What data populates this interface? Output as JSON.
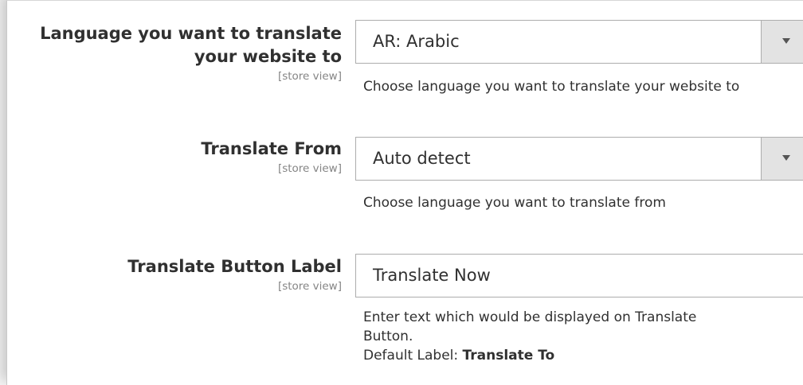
{
  "fields": [
    {
      "label_line1": "Language you want to translate",
      "label_line2": "your website to",
      "scope": "[store view]",
      "value": "AR: Arabic",
      "note": "Choose language you want to translate your website to"
    },
    {
      "label": "Translate From",
      "scope": "[store view]",
      "value": "Auto detect",
      "note": "Choose language you want to translate from"
    },
    {
      "label": "Translate Button Label",
      "scope": "[store view]",
      "value": "Translate Now",
      "note_line1": "Enter text which would be displayed on Translate",
      "note_line2": "Button.",
      "default_prefix": "Default Label: ",
      "default_value": "Translate To"
    }
  ],
  "icons": {
    "dropdown": "caret-down-icon"
  }
}
